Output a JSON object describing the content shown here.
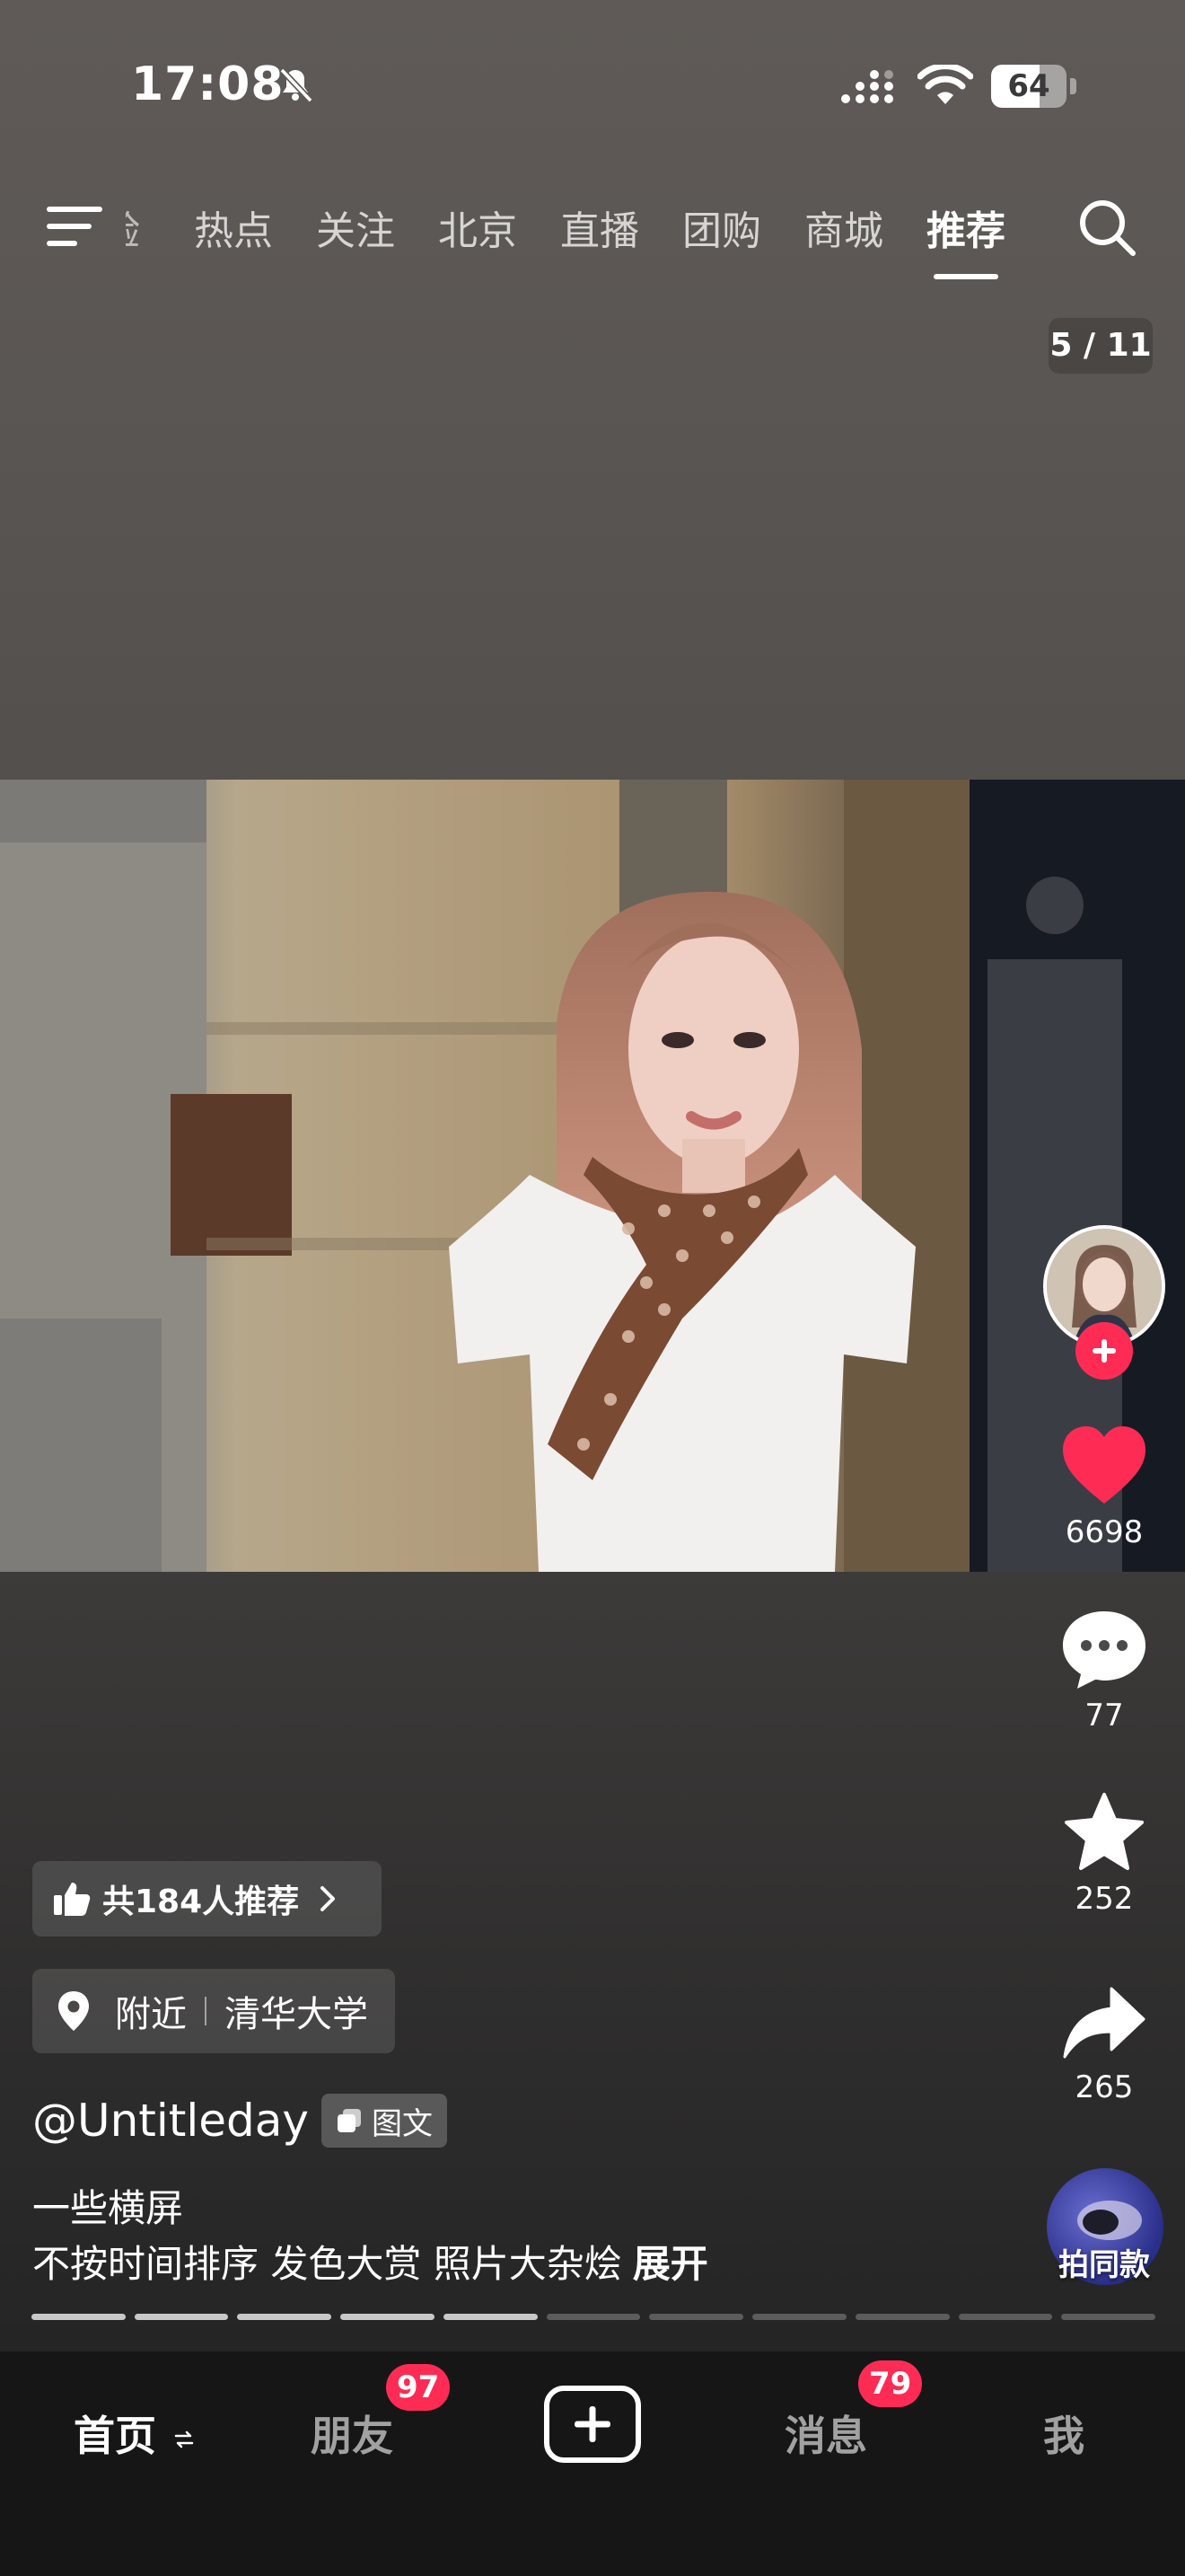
{
  "status_bar": {
    "time": "17:08",
    "battery": "64",
    "battery_level": 0.64
  },
  "top_nav": {
    "tabs": [
      {
        "label": "验",
        "clipped": true
      },
      {
        "label": "热点"
      },
      {
        "label": "关注"
      },
      {
        "label": "北京"
      },
      {
        "label": "直播"
      },
      {
        "label": "团购"
      },
      {
        "label": "商城"
      },
      {
        "label": "推荐",
        "active": true
      }
    ]
  },
  "page_counter": "5 / 11",
  "rail": {
    "likes": "6698",
    "comments": "77",
    "favorites": "252",
    "shares": "265",
    "same_style_label": "拍同款",
    "like_color": "#fe2c55"
  },
  "post": {
    "recommend": "共184人推荐",
    "location_prefix": "附近",
    "location_name": "清华大学",
    "author": "@Untitleday",
    "type_label": "图文",
    "caption_line1": "一些横屏",
    "caption_line2": "不按时间排序 发色大赏 照片大杂烩",
    "expand": "展开"
  },
  "progress": {
    "total": 11,
    "current": 5
  },
  "bottom_nav": {
    "home": "首页",
    "friends": "朋友",
    "friends_badge": "97",
    "messages": "消息",
    "messages_badge": "79",
    "me": "我"
  },
  "colors": {
    "accent": "#fe2c55",
    "nav_bg": "#161616"
  }
}
